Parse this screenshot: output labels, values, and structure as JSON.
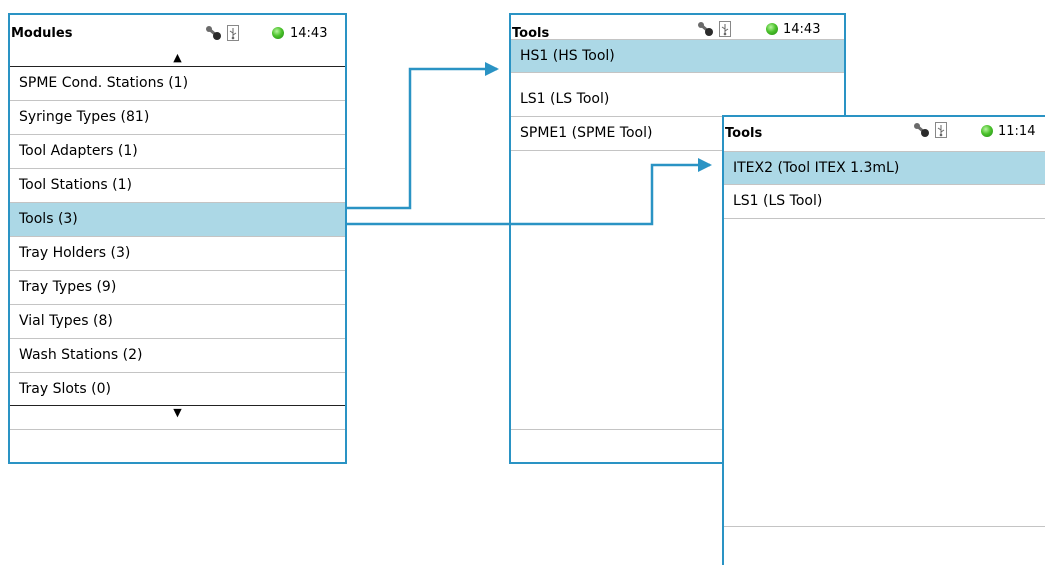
{
  "panels": {
    "modules": {
      "title": "Modules",
      "time": "14:43",
      "scroll_up": "▲",
      "scroll_down": "▼",
      "items": [
        "SPME Cond. Stations (1)",
        "Syringe Types (81)",
        "Tool Adapters (1)",
        "Tool Stations (1)",
        "Tools (3)",
        "Tray Holders (3)",
        "Tray Types (9)",
        "Vial Types (8)",
        "Wash Stations (2)",
        "Tray Slots (0)"
      ],
      "selected": "Tools (3)"
    },
    "tools_a": {
      "title": "Tools",
      "time": "14:43",
      "items": [
        "HS1 (HS Tool)",
        "LS1 (LS Tool)",
        "SPME1 (SPME Tool)"
      ],
      "selected": "HS1 (HS Tool)"
    },
    "tools_b": {
      "title": "Tools",
      "time": "11:14",
      "items": [
        "ITEX2 (Tool ITEX 1.3mL)",
        "LS1 (LS Tool)"
      ],
      "selected": "ITEX2 (Tool ITEX 1.3mL)"
    }
  },
  "icons": [
    "wrench-icon",
    "usb-icon",
    "status-led-icon"
  ],
  "colors": {
    "frame": "#2a93c4",
    "selection": "#acd8e6",
    "status_led": "#4cc22c",
    "separator": "#c4c4c4"
  }
}
